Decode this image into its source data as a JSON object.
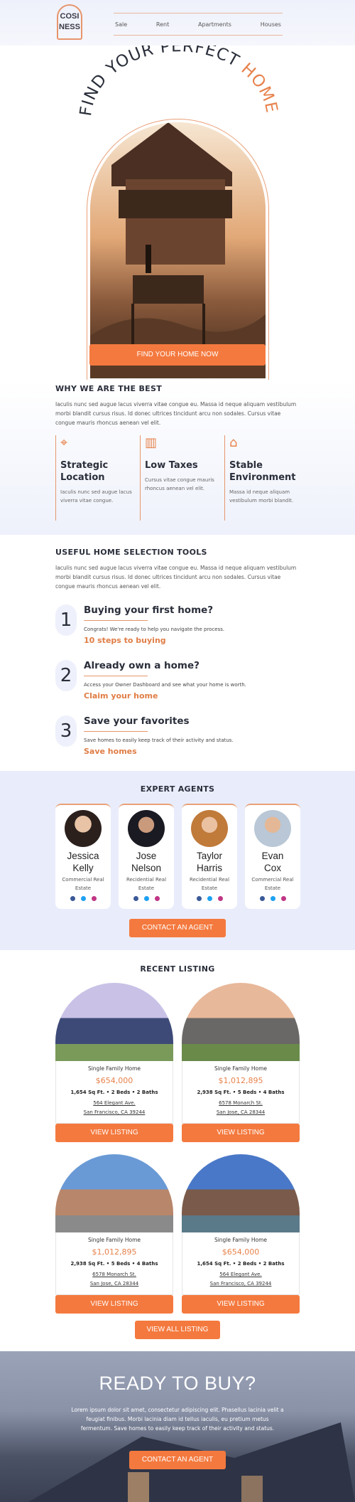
{
  "header": {
    "logo_line1": "COSI",
    "logo_line2": "NESS",
    "nav": [
      "Sale",
      "Rent",
      "Apartments",
      "Houses"
    ]
  },
  "hero": {
    "title_main": "FIND YOUR PERFECT",
    "title_accent": "HOME",
    "cta": "FIND YOUR HOME NOW"
  },
  "why": {
    "title": "WHY WE ARE THE BEST",
    "text": "Iaculis nunc sed augue lacus viverra vitae congue eu. Massa id neque aliquam vestibulum morbi blandit cursus risus. Id donec ultrices tincidunt arcu non sodales. Cursus vitae congue mauris rhoncus aenean vel elit.",
    "features": [
      {
        "icon": "location-pin-icon",
        "title": "Strategic Location",
        "text": "Iaculis nunc sed augue lacus viverra vitae congue."
      },
      {
        "icon": "tax-building-icon",
        "title": "Low Taxes",
        "text": "Cursus vitae congue mauris rhoncus aenean vel elit."
      },
      {
        "icon": "hands-house-icon",
        "title": "Stable Environment",
        "text": "Massa id neque aliquam vestibulum morbi blandit."
      }
    ]
  },
  "tools": {
    "title": "USEFUL HOME SELECTION TOOLS",
    "text": "Iaculis nunc sed augue lacus viverra vitae congue eu. Massa id neque aliquam vestibulum morbi blandit cursus risus. Id donec ultrices tincidunt arcu non sodales. Cursus vitae congue mauris rhoncus aenean vel elit.",
    "steps": [
      {
        "num": "1",
        "title": "Buying your first home?",
        "text": "Congrats! We're ready to help you navigate the process.",
        "link": "10 steps to buying"
      },
      {
        "num": "2",
        "title": "Already own a home?",
        "text": "Access your Owner Dashboard and see what your home is worth.",
        "link": "Claim your home"
      },
      {
        "num": "3",
        "title": "Save your favorites",
        "text": "Save homes to easily keep track of their activity and status.",
        "link": "Save homes"
      }
    ]
  },
  "agents": {
    "title": "EXPERT AGENTS",
    "list": [
      {
        "name_first": "Jessica",
        "name_last": "Kelly",
        "role": "Commercial Real Estate"
      },
      {
        "name_first": "Jose",
        "name_last": "Nelson",
        "role": "Recidential Real Estate"
      },
      {
        "name_first": "Taylor",
        "name_last": "Harris",
        "role": "Recidential Real Estate"
      },
      {
        "name_first": "Evan",
        "name_last": "Cox",
        "role": "Commercial Real Estate"
      }
    ],
    "cta": "CONTACT AN AGENT"
  },
  "listings": {
    "title": "RECENT LISTING",
    "cards": [
      {
        "type": "Single Family Home",
        "price": "$654,000",
        "details": "1,654 Sq Ft. • 2 Beds • 2 Baths",
        "street": "564 Elegant Ave.",
        "city": "San Francisco, CA 39244",
        "cta": "VIEW LISTING"
      },
      {
        "type": "Single Family Home",
        "price": "$1,012,895",
        "details": "2,938 Sq Ft. • 5 Beds • 4 Baths",
        "street": "6578 Monarch St.",
        "city": "San Jose, CA 28344",
        "cta": "VIEW LISTING"
      },
      {
        "type": "Single Family Home",
        "price": "$1,012,895",
        "details": "2,938 Sq Ft. • 5 Beds • 4 Baths",
        "street": "6578 Monarch St.",
        "city": "San Jose, CA 28344",
        "cta": "VIEW LISTING"
      },
      {
        "type": "Single Family Home",
        "price": "$654,000",
        "details": "1,654 Sq Ft. • 2 Beds • 2 Baths",
        "street": "564 Elegant Ave.",
        "city": "San Francisco, CA 39244",
        "cta": "VIEW LISTING"
      }
    ],
    "view_all": "VIEW ALL LISTING"
  },
  "ready": {
    "title": "READY TO BUY?",
    "text": "Lorem ipsum dolor sit amet, consectetur adipiscing elit. Phasellus lacinia velit a feugiat finibus. Morbi lacinia diam id tellus iaculis, eu pretium metus fermentum. Save homes to easily keep track of their activity and status.",
    "cta": "CONTACT AN AGENT"
  },
  "colors": {
    "accent": "#f4793e",
    "text": "#2b2f38",
    "panel": "#eef1fb"
  }
}
